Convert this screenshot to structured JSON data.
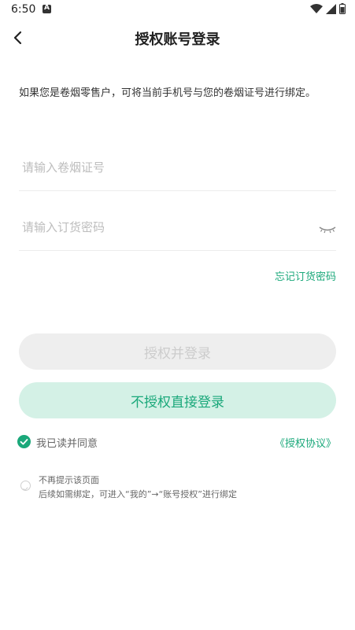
{
  "status_bar": {
    "time": "6:50",
    "notif_icon": "a-notification-icon",
    "icons": [
      "wifi-icon",
      "signal-icon",
      "battery-icon"
    ]
  },
  "header": {
    "title": "授权账号登录",
    "back_icon": "chevron-left-icon"
  },
  "notice": "如果您是卷烟零售户，可将当前手机号与您的卷烟证号进行绑定。",
  "license_input": {
    "placeholder": "请输入卷烟证号",
    "value": ""
  },
  "password_input": {
    "placeholder": "请输入订货密码",
    "value": "",
    "toggle_icon": "eye-closed-icon"
  },
  "forgot_link": "忘记订货密码",
  "buttons": {
    "authorize_login": "授权并登录",
    "no_authorize_login": "不授权直接登录"
  },
  "agreement": {
    "checked": true,
    "text": "我已读并同意",
    "link": "《授权协议》"
  },
  "remind": {
    "checked": false,
    "title": "不再提示该页面",
    "subtitle": "后续如需绑定，可进入“我的”→“账号授权”进行绑定"
  },
  "colors": {
    "accent": "#1aa87a",
    "accent_light": "#d4f1e6",
    "disabled_bg": "#eeeeee",
    "disabled_text": "#cccccc"
  }
}
